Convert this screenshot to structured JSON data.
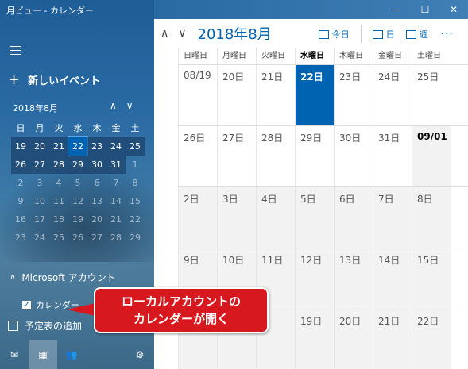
{
  "window": {
    "title": "月ビュー - カレンダー",
    "minimize": "—",
    "maximize": "☐",
    "close": "✕"
  },
  "left": {
    "new_event": "新しいイベント",
    "mini_month": "2018年8月",
    "weekdays": [
      "日",
      "月",
      "火",
      "水",
      "木",
      "金",
      "土"
    ],
    "weeks": [
      [
        "19",
        "20",
        "21",
        "22",
        "23",
        "24",
        "25"
      ],
      [
        "26",
        "27",
        "28",
        "29",
        "30",
        "31",
        "1"
      ],
      [
        "2",
        "3",
        "4",
        "5",
        "6",
        "7",
        "8"
      ],
      [
        "9",
        "10",
        "11",
        "12",
        "13",
        "14",
        "15"
      ],
      [
        "16",
        "17",
        "18",
        "19",
        "20",
        "21",
        "22"
      ],
      [
        "23",
        "24",
        "25",
        "26",
        "27",
        "28",
        "29"
      ]
    ],
    "account_label": "Microsoft アカウント",
    "calendar_label": "カレンダー",
    "add_calendar": "予定表の追加"
  },
  "header": {
    "month_title": "2018年8月",
    "today_label": "今日",
    "day_label": "日",
    "week_label": "週",
    "more": "···"
  },
  "grid": {
    "weekdays": [
      "日曜日",
      "月曜日",
      "火曜日",
      "水曜日",
      "木曜日",
      "金曜日",
      "土曜日"
    ],
    "weeks": [
      [
        "08/19",
        "20日",
        "21日",
        "22日",
        "23日",
        "24日",
        "25日"
      ],
      [
        "26日",
        "27日",
        "28日",
        "29日",
        "30日",
        "31日",
        "09/01"
      ],
      [
        "2日",
        "3日",
        "4日",
        "5日",
        "6日",
        "7日",
        "8日"
      ],
      [
        "9日",
        "10日",
        "11日",
        "12日",
        "13日",
        "14日",
        "15日"
      ],
      [
        "",
        "",
        "",
        "",
        "19日",
        "20日",
        "21日",
        "22日"
      ]
    ]
  },
  "callout": {
    "line1": "ローカルアカウントの",
    "line2": "カレンダーが開く"
  },
  "colors": {
    "accent": "#0063b1",
    "callout": "#d7191f"
  }
}
